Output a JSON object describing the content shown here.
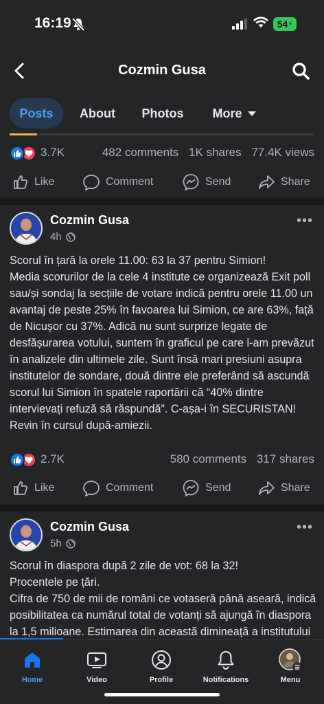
{
  "status": {
    "time": "16:19",
    "battery": "54"
  },
  "header": {
    "title": "Cozmin Gusa"
  },
  "tabs": [
    {
      "label": "Posts"
    },
    {
      "label": "About"
    },
    {
      "label": "Photos"
    },
    {
      "label": "More"
    }
  ],
  "post0": {
    "reactions": "3.7K",
    "comments": "482 comments",
    "shares": "1K shares",
    "views": "77.4K views"
  },
  "actions": {
    "like": "Like",
    "comment": "Comment",
    "send": "Send",
    "share": "Share"
  },
  "post1": {
    "author": "Cozmin Gusa",
    "time": "4h",
    "text": "Scorul în țară la orele 11.00: 63 la 37 pentru Simion!\nMedia scorurilor de la cele 4 institute ce organizează Exit poll sau/și sondaj la secțiile de votare indică pentru orele 11.00 un avantaj de peste 25% în favoarea lui Simion, ce are 63%, față de Nicușor cu 37%. Adică nu sunt surprize legate de desfășurarea votului, suntem în graficul pe care l-am prevăzut în analizele din ultimele zile. Sunt însă mari presiuni asupra institutelor de sondare, două dintre ele preferând să ascundă scorul lui Simion în spatele raportării că “40% dintre intervievați refuză să răspundă”. C-așa-i în SECURISTAN! Revin în cursul după-amiezii.",
    "reactions": "2.7K",
    "comments": "580 comments",
    "shares": "317 shares"
  },
  "post2": {
    "author": "Cozmin Gusa",
    "time": "5h",
    "text": "Scorul în diaspora după 2 zile de vot: 68 la 32!\nProcentele pe țări.\nCifra de 750 de mii de români ce votaseră până aseară, indică posibilitatea ca numărul total de votanți să ajungă în diaspora la 1,5 milioane. Estimarea din această dimineață a institutului ce s-a organizat"
  },
  "nav": [
    {
      "label": "Home"
    },
    {
      "label": "Video"
    },
    {
      "label": "Profile"
    },
    {
      "label": "Notifications"
    },
    {
      "label": "Menu"
    }
  ],
  "colors": {
    "accent": "#1877f2",
    "background": "#242526",
    "love": "#f33e58"
  }
}
